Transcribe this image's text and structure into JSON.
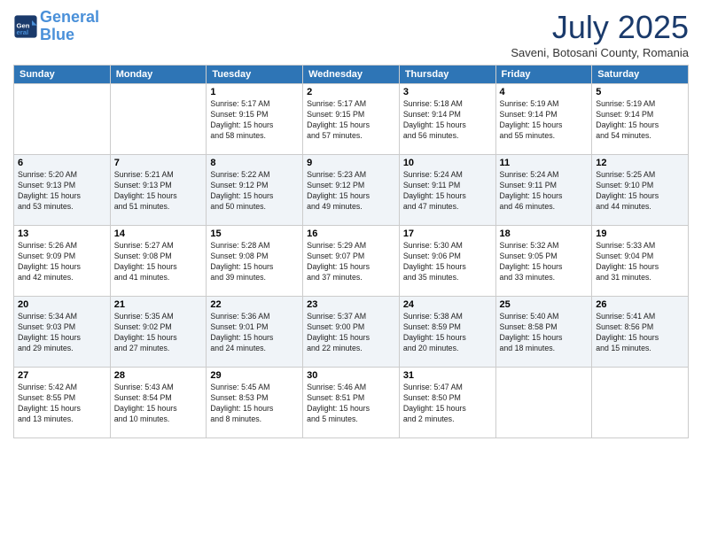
{
  "logo": {
    "line1": "General",
    "line2": "Blue"
  },
  "title": "July 2025",
  "subtitle": "Saveni, Botosani County, Romania",
  "days_header": [
    "Sunday",
    "Monday",
    "Tuesday",
    "Wednesday",
    "Thursday",
    "Friday",
    "Saturday"
  ],
  "weeks": [
    [
      {
        "day": "",
        "info": ""
      },
      {
        "day": "",
        "info": ""
      },
      {
        "day": "1",
        "info": "Sunrise: 5:17 AM\nSunset: 9:15 PM\nDaylight: 15 hours\nand 58 minutes."
      },
      {
        "day": "2",
        "info": "Sunrise: 5:17 AM\nSunset: 9:15 PM\nDaylight: 15 hours\nand 57 minutes."
      },
      {
        "day": "3",
        "info": "Sunrise: 5:18 AM\nSunset: 9:14 PM\nDaylight: 15 hours\nand 56 minutes."
      },
      {
        "day": "4",
        "info": "Sunrise: 5:19 AM\nSunset: 9:14 PM\nDaylight: 15 hours\nand 55 minutes."
      },
      {
        "day": "5",
        "info": "Sunrise: 5:19 AM\nSunset: 9:14 PM\nDaylight: 15 hours\nand 54 minutes."
      }
    ],
    [
      {
        "day": "6",
        "info": "Sunrise: 5:20 AM\nSunset: 9:13 PM\nDaylight: 15 hours\nand 53 minutes."
      },
      {
        "day": "7",
        "info": "Sunrise: 5:21 AM\nSunset: 9:13 PM\nDaylight: 15 hours\nand 51 minutes."
      },
      {
        "day": "8",
        "info": "Sunrise: 5:22 AM\nSunset: 9:12 PM\nDaylight: 15 hours\nand 50 minutes."
      },
      {
        "day": "9",
        "info": "Sunrise: 5:23 AM\nSunset: 9:12 PM\nDaylight: 15 hours\nand 49 minutes."
      },
      {
        "day": "10",
        "info": "Sunrise: 5:24 AM\nSunset: 9:11 PM\nDaylight: 15 hours\nand 47 minutes."
      },
      {
        "day": "11",
        "info": "Sunrise: 5:24 AM\nSunset: 9:11 PM\nDaylight: 15 hours\nand 46 minutes."
      },
      {
        "day": "12",
        "info": "Sunrise: 5:25 AM\nSunset: 9:10 PM\nDaylight: 15 hours\nand 44 minutes."
      }
    ],
    [
      {
        "day": "13",
        "info": "Sunrise: 5:26 AM\nSunset: 9:09 PM\nDaylight: 15 hours\nand 42 minutes."
      },
      {
        "day": "14",
        "info": "Sunrise: 5:27 AM\nSunset: 9:08 PM\nDaylight: 15 hours\nand 41 minutes."
      },
      {
        "day": "15",
        "info": "Sunrise: 5:28 AM\nSunset: 9:08 PM\nDaylight: 15 hours\nand 39 minutes."
      },
      {
        "day": "16",
        "info": "Sunrise: 5:29 AM\nSunset: 9:07 PM\nDaylight: 15 hours\nand 37 minutes."
      },
      {
        "day": "17",
        "info": "Sunrise: 5:30 AM\nSunset: 9:06 PM\nDaylight: 15 hours\nand 35 minutes."
      },
      {
        "day": "18",
        "info": "Sunrise: 5:32 AM\nSunset: 9:05 PM\nDaylight: 15 hours\nand 33 minutes."
      },
      {
        "day": "19",
        "info": "Sunrise: 5:33 AM\nSunset: 9:04 PM\nDaylight: 15 hours\nand 31 minutes."
      }
    ],
    [
      {
        "day": "20",
        "info": "Sunrise: 5:34 AM\nSunset: 9:03 PM\nDaylight: 15 hours\nand 29 minutes."
      },
      {
        "day": "21",
        "info": "Sunrise: 5:35 AM\nSunset: 9:02 PM\nDaylight: 15 hours\nand 27 minutes."
      },
      {
        "day": "22",
        "info": "Sunrise: 5:36 AM\nSunset: 9:01 PM\nDaylight: 15 hours\nand 24 minutes."
      },
      {
        "day": "23",
        "info": "Sunrise: 5:37 AM\nSunset: 9:00 PM\nDaylight: 15 hours\nand 22 minutes."
      },
      {
        "day": "24",
        "info": "Sunrise: 5:38 AM\nSunset: 8:59 PM\nDaylight: 15 hours\nand 20 minutes."
      },
      {
        "day": "25",
        "info": "Sunrise: 5:40 AM\nSunset: 8:58 PM\nDaylight: 15 hours\nand 18 minutes."
      },
      {
        "day": "26",
        "info": "Sunrise: 5:41 AM\nSunset: 8:56 PM\nDaylight: 15 hours\nand 15 minutes."
      }
    ],
    [
      {
        "day": "27",
        "info": "Sunrise: 5:42 AM\nSunset: 8:55 PM\nDaylight: 15 hours\nand 13 minutes."
      },
      {
        "day": "28",
        "info": "Sunrise: 5:43 AM\nSunset: 8:54 PM\nDaylight: 15 hours\nand 10 minutes."
      },
      {
        "day": "29",
        "info": "Sunrise: 5:45 AM\nSunset: 8:53 PM\nDaylight: 15 hours\nand 8 minutes."
      },
      {
        "day": "30",
        "info": "Sunrise: 5:46 AM\nSunset: 8:51 PM\nDaylight: 15 hours\nand 5 minutes."
      },
      {
        "day": "31",
        "info": "Sunrise: 5:47 AM\nSunset: 8:50 PM\nDaylight: 15 hours\nand 2 minutes."
      },
      {
        "day": "",
        "info": ""
      },
      {
        "day": "",
        "info": ""
      }
    ]
  ]
}
